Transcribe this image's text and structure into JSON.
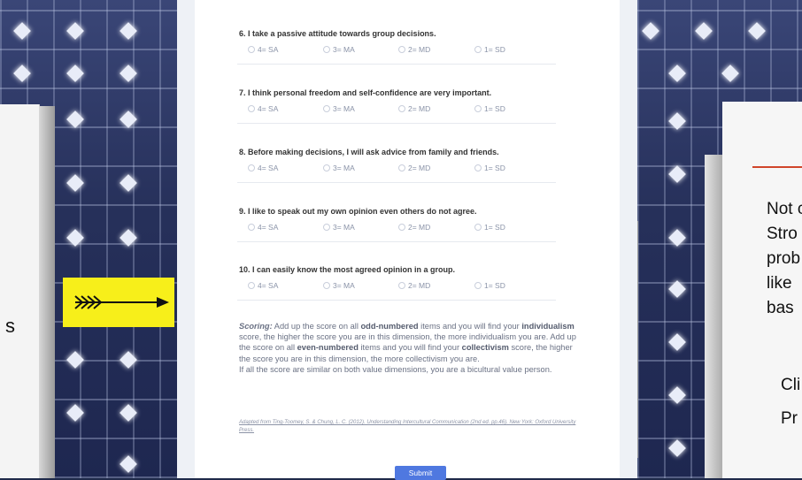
{
  "questions": [
    {
      "title": "6. I take a passive attitude towards group decisions."
    },
    {
      "title": "7. I think personal freedom and self-confidence are very important."
    },
    {
      "title": "8. Before making decisions, I will ask advice from family and friends."
    },
    {
      "title": "9. I like to speak out my own opinion even others do not agree."
    },
    {
      "title": "10. I can easily know the most agreed opinion in a group."
    }
  ],
  "options": {
    "sa": "4= SA",
    "ma": "3= MA",
    "md": "2= MD",
    "sd": "1= SD"
  },
  "scoring": {
    "lead": "Scoring:",
    "t1": " Add up the score on all ",
    "b1": "odd-numbered",
    "t2": " items and you will find your ",
    "b2": "individualism",
    "t3": " score, the higher the score you are in this dimension, the more individualism you are. Add up the score on all ",
    "b3": "even-numbered",
    "t4": " items and you will find your ",
    "b4": "collectivism",
    "t5": " score, the higher the score you are in this dimension, the more collectivism you are.",
    "t6": "If all the score are similar on both value dimensions, you are a bicultural value person."
  },
  "citation": "Adapted from Ting-Toomey, S. & Chung, L. C. (2012). Understanding Intercultural Communication (2nd ed. pp.46). New York: Oxford University Press.",
  "submit_label": "Submit",
  "left_panel": {
    "card_text": "s"
  },
  "right_panel": {
    "lines": "Not c\nStro\nprob\nlike\nbas",
    "lines2": "Cli\nPr"
  },
  "colors": {
    "accent": "#4f78e0",
    "arrow_bg": "#f7ef1a"
  }
}
